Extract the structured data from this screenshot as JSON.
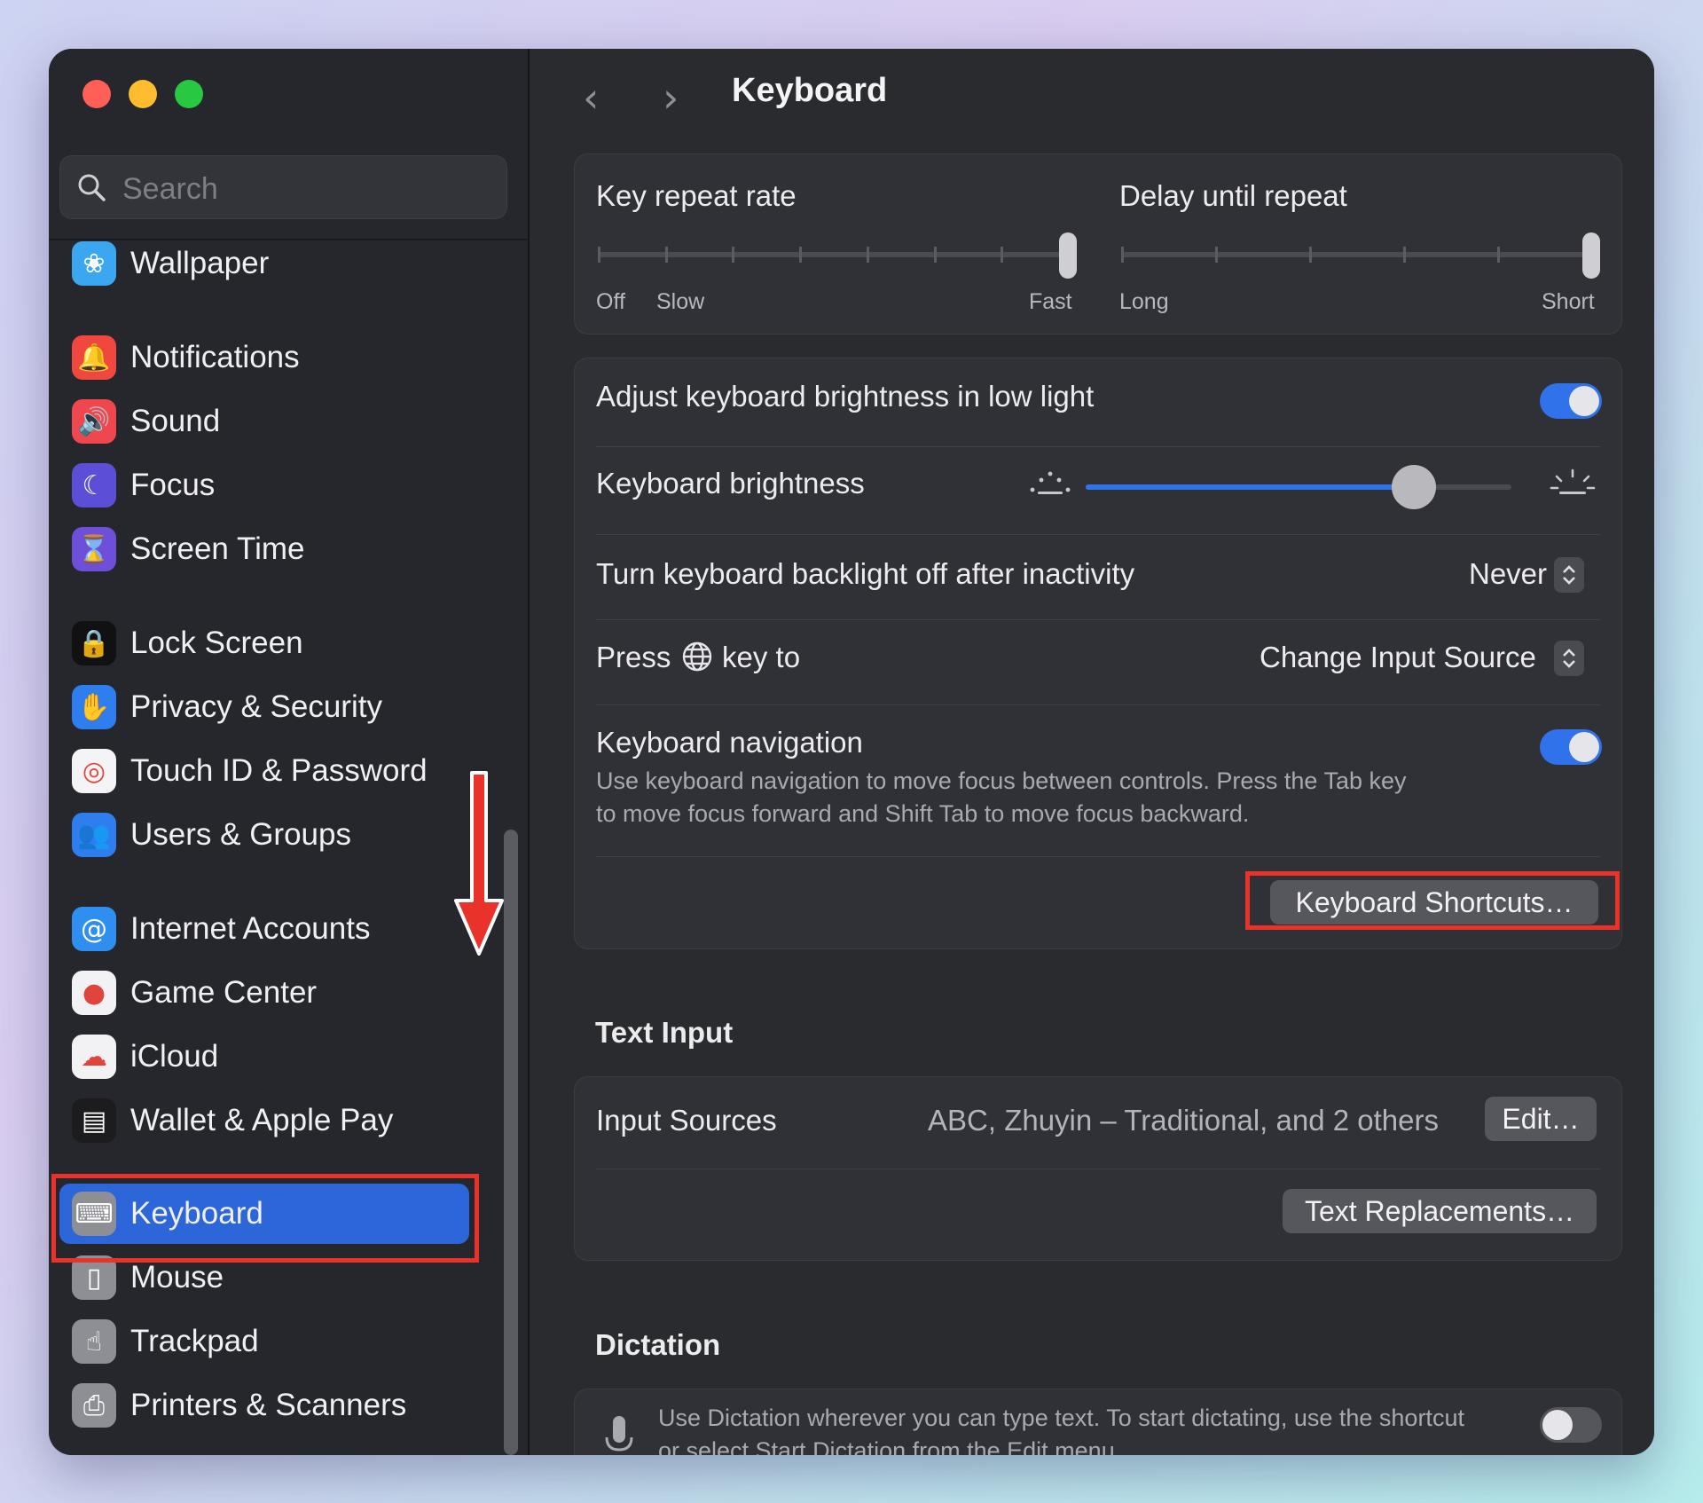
{
  "window": {
    "title": "Keyboard"
  },
  "sidebar": {
    "search_placeholder": "Search",
    "items": [
      {
        "label": "Wallpaper",
        "icon": "wallpaper-icon",
        "color": "#3aa7f0",
        "glyph": "❀"
      },
      {
        "label": "Notifications",
        "icon": "notifications-icon",
        "color": "#f0473f",
        "glyph": "🔔"
      },
      {
        "label": "Sound",
        "icon": "sound-icon",
        "color": "#f0474f",
        "glyph": "🔊"
      },
      {
        "label": "Focus",
        "icon": "focus-icon",
        "color": "#5b4fd8",
        "glyph": "☾"
      },
      {
        "label": "Screen Time",
        "icon": "screen-time-icon",
        "color": "#6e4fd9",
        "glyph": "⌛"
      },
      {
        "label": "Lock Screen",
        "icon": "lock-screen-icon",
        "color": "#111114",
        "glyph": "🔒"
      },
      {
        "label": "Privacy & Security",
        "icon": "privacy-hand-icon",
        "color": "#2f7ef0",
        "glyph": "✋"
      },
      {
        "label": "Touch ID & Password",
        "icon": "fingerprint-icon",
        "color": "#f4f4f6",
        "glyph": "◎"
      },
      {
        "label": "Users & Groups",
        "icon": "users-icon",
        "color": "#2f7ef0",
        "glyph": "👥"
      },
      {
        "label": "Internet Accounts",
        "icon": "at-sign-icon",
        "color": "#2f8ff0",
        "glyph": "@"
      },
      {
        "label": "Game Center",
        "icon": "game-center-icon",
        "color": "#f2f2f4",
        "glyph": "●"
      },
      {
        "label": "iCloud",
        "icon": "icloud-icon",
        "color": "#f2f2f4",
        "glyph": "☁"
      },
      {
        "label": "Wallet & Apple Pay",
        "icon": "wallet-icon",
        "color": "#1c1c1e",
        "glyph": "▤"
      },
      {
        "label": "Keyboard",
        "icon": "keyboard-icon",
        "color": "#8e8f95",
        "glyph": "⌨"
      },
      {
        "label": "Mouse",
        "icon": "mouse-icon",
        "color": "#8e8f95",
        "glyph": "▯"
      },
      {
        "label": "Trackpad",
        "icon": "trackpad-icon",
        "color": "#8e8f95",
        "glyph": "☝"
      },
      {
        "label": "Printers & Scanners",
        "icon": "printer-icon",
        "color": "#8e8f95",
        "glyph": "⎙"
      }
    ],
    "active_item": "Keyboard"
  },
  "key_repeat": {
    "rate_label": "Key repeat rate",
    "rate_ticks": [
      "Off",
      "Slow",
      "Fast"
    ],
    "rate_value_fraction": 1.0,
    "delay_label": "Delay until repeat",
    "delay_ticks": [
      "Long",
      "Short"
    ],
    "delay_value_fraction": 1.0
  },
  "brightness": {
    "adjust_label": "Adjust keyboard brightness in low light",
    "adjust_on": true,
    "brightness_label": "Keyboard brightness",
    "brightness_fraction": 0.77,
    "backlight_label": "Turn keyboard backlight off after inactivity",
    "backlight_value": "Never",
    "press_label_pre": "Press",
    "press_label_post": "key to",
    "press_value": "Change Input Source",
    "nav_label": "Keyboard navigation",
    "nav_on": true,
    "nav_desc_1": "Use keyboard navigation to move focus between controls. Press the Tab key",
    "nav_desc_2": "to move focus forward and Shift Tab to move focus backward.",
    "shortcuts_button": "Keyboard Shortcuts…"
  },
  "text_input": {
    "section": "Text Input",
    "sources_label": "Input Sources",
    "sources_value": "ABC, Zhuyin – Traditional, and 2 others",
    "edit_button": "Edit…",
    "replacements_button": "Text Replacements…"
  },
  "dictation": {
    "section": "Dictation",
    "desc_1": "Use Dictation wherever you can type text. To start dictating, use the shortcut",
    "desc_2": "or select Start Dictation from the Edit menu.",
    "enabled": false
  },
  "colors": {
    "accent": "#2c66d9",
    "highlight": "#e8322a"
  }
}
